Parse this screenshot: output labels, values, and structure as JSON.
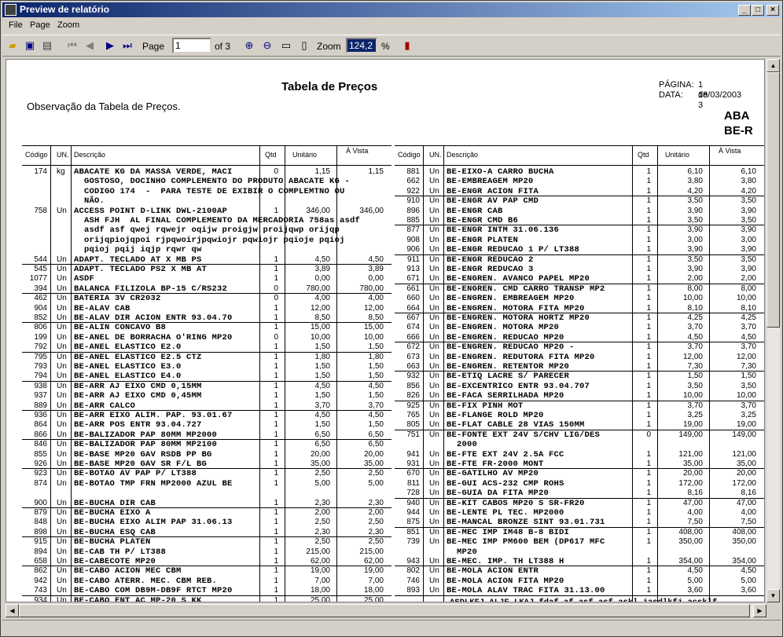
{
  "window": {
    "title": "Preview de relatório"
  },
  "menu": [
    "File",
    "Page",
    "Zoom"
  ],
  "toolbar": {
    "page_label": "Page",
    "page_value": "1",
    "of_label": "of 3",
    "zoom_label": "Zoom",
    "zoom_value": "124,2",
    "percent": "%"
  },
  "report": {
    "title": "Tabela de Preços",
    "observation": "Observação da Tabela de Preços.",
    "page_label": "PÁGINA:",
    "page_value": "1 de 3",
    "date_label": "DATA:",
    "date_value": "18/03/2003",
    "aba1": "ABA",
    "aba2": "BE-R"
  },
  "headers": {
    "code": "Código",
    "unit": "UN.",
    "desc": "Descrição",
    "qty": "Qtd",
    "unit_price": "Unitário",
    "cash": "À Vista"
  },
  "left_rows": [
    {
      "c": "174",
      "u": "kg",
      "d": [
        "ABACATE KG DA MASSA VERDE, MACI",
        "  GOSTOSO, DOCINHO COMPLEMENTO DO PRODUTO ABACATE KG -",
        "  CODIGO 174  -  PARA TESTE DE EXIBIR O COMPLEMTNO OU",
        "  NÃO."
      ],
      "q": "0",
      "p1": "1,15",
      "p2": "1,15"
    },
    {
      "c": "758",
      "u": "Un",
      "d": [
        "ACCESS POINT D-LINK DWL-2100AP",
        "  ASH FJH  AL FINAL COMPLEMENTO DA MERCADORIA 758as asdf",
        "  asdf asf qwej rqwejr oqijw proigjw proijqwp orijqp",
        "  orijqpiojqpoi rjpqwoirjpqwiojr pqwiojr pqioje pqioj",
        "  pqioj pqij iqjp rqwr qw"
      ],
      "q": "1",
      "p1": "346,00",
      "p2": "346,00"
    },
    {
      "c": "544",
      "u": "Un",
      "d": [
        "ADAPT. TECLADO AT X MB PS"
      ],
      "q": "1",
      "p1": "4,50",
      "p2": "4,50"
    },
    {
      "c": "545",
      "u": "Un",
      "d": [
        "ADAPT. TECLADO PS2 X MB AT"
      ],
      "q": "1",
      "p1": "3,89",
      "p2": "3,89"
    },
    {
      "c": "1077",
      "u": "Un",
      "d": [
        "ASDF"
      ],
      "q": "1",
      "p1": "0,00",
      "p2": "0,00"
    },
    {
      "c": "394",
      "u": "Un",
      "d": [
        "BALANCA FILIZOLA BP-15 C/RS232"
      ],
      "q": "0",
      "p1": "780,00",
      "p2": "780,00"
    },
    {
      "c": "462",
      "u": "Un",
      "d": [
        "BATERIA 3V CR2032"
      ],
      "q": "0",
      "p1": "4,00",
      "p2": "4,00"
    },
    {
      "c": "904",
      "u": "Un",
      "d": [
        "BE-ALAV CAB"
      ],
      "q": "1",
      "p1": "12,00",
      "p2": "12,00"
    },
    {
      "c": "852",
      "u": "Un",
      "d": [
        "BE-ALAV DIR ACION ENTR 93.04.70"
      ],
      "q": "1",
      "p1": "8,50",
      "p2": "8,50"
    },
    {
      "c": "806",
      "u": "Un",
      "d": [
        "BE-ALIN CONCAVO B8"
      ],
      "q": "1",
      "p1": "15,00",
      "p2": "15,00"
    },
    {
      "c": "199",
      "u": "Un",
      "d": [
        "BE-ANEL DE BORRACHA O'RING MP20"
      ],
      "q": "0",
      "p1": "10,00",
      "p2": "10,00"
    },
    {
      "c": "792",
      "u": "Un",
      "d": [
        "BE-ANEL ELASTICO E2.0"
      ],
      "q": "1",
      "p1": "1,50",
      "p2": "1,50"
    },
    {
      "c": "795",
      "u": "Un",
      "d": [
        "BE-ANEL ELASTICO E2.5 CTZ"
      ],
      "q": "1",
      "p1": "1,80",
      "p2": "1,80"
    },
    {
      "c": "793",
      "u": "Un",
      "d": [
        "BE-ANEL ELASTICO E3.0"
      ],
      "q": "1",
      "p1": "1,50",
      "p2": "1,50"
    },
    {
      "c": "794",
      "u": "Un",
      "d": [
        "BE-ANEL ELASTICO E4.0"
      ],
      "q": "1",
      "p1": "1,50",
      "p2": "1,50"
    },
    {
      "c": "938",
      "u": "Un",
      "d": [
        "BE-ARR AJ EIXO CMD 0,15MM"
      ],
      "q": "1",
      "p1": "4,50",
      "p2": "4,50"
    },
    {
      "c": "937",
      "u": "Un",
      "d": [
        "BE-ARR AJ EIXO CMD 0,45MM"
      ],
      "q": "1",
      "p1": "1,50",
      "p2": "1,50"
    },
    {
      "c": "889",
      "u": "Un",
      "d": [
        "BE-ARR CALCO"
      ],
      "q": "1",
      "p1": "3,70",
      "p2": "3,70"
    },
    {
      "c": "936",
      "u": "Un",
      "d": [
        "BE-ARR EIXO ALIM. PAP. 93.01.67"
      ],
      "q": "1",
      "p1": "4,50",
      "p2": "4,50"
    },
    {
      "c": "864",
      "u": "Un",
      "d": [
        "BE-ARR POS ENTR 93.04.727"
      ],
      "q": "1",
      "p1": "1,50",
      "p2": "1,50"
    },
    {
      "c": "866",
      "u": "Un",
      "d": [
        "BE-BALIZADOR PAP 80MM MP2000"
      ],
      "q": "1",
      "p1": "6,50",
      "p2": "6,50"
    },
    {
      "c": "846",
      "u": "Un",
      "d": [
        "BE-BALIZADOR PAP 80MM MP2100"
      ],
      "q": "1",
      "p1": "6,50",
      "p2": "6,50"
    },
    {
      "c": "855",
      "u": "Un",
      "d": [
        "BE-BASE MP20 GAV RSDB PP BG"
      ],
      "q": "1",
      "p1": "20,00",
      "p2": "20,00"
    },
    {
      "c": "926",
      "u": "Un",
      "d": [
        "BE-BASE MP20 GAV SR F/L BG"
      ],
      "q": "1",
      "p1": "35,00",
      "p2": "35,00"
    },
    {
      "c": "923",
      "u": "Un",
      "d": [
        "BE-BOTAO AV PAP P/ LT388"
      ],
      "q": "1",
      "p1": "2,50",
      "p2": "2,50"
    },
    {
      "c": "874",
      "u": "Un",
      "d": [
        "BE-BOTAO TMP FRN MP2000 AZUL BE",
        ""
      ],
      "q": "1",
      "p1": "5,00",
      "p2": "5,00"
    },
    {
      "c": "900",
      "u": "Un",
      "d": [
        "BE-BUCHA DIR CAB"
      ],
      "q": "1",
      "p1": "2,30",
      "p2": "2,30"
    },
    {
      "c": "879",
      "u": "Un",
      "d": [
        "BE-BUCHA EIXO A"
      ],
      "q": "1",
      "p1": "2,00",
      "p2": "2,00"
    },
    {
      "c": "848",
      "u": "Un",
      "d": [
        "BE-BUCHA EIXO ALIM PAP 31.06.13"
      ],
      "q": "1",
      "p1": "2,50",
      "p2": "2,50"
    },
    {
      "c": "898",
      "u": "Un",
      "d": [
        "BE-BUCHA ESQ CAB"
      ],
      "q": "1",
      "p1": "2,30",
      "p2": "2,30"
    },
    {
      "c": "915",
      "u": "Un",
      "d": [
        "BE-BUCHA PLATEN"
      ],
      "q": "1",
      "p1": "2,50",
      "p2": "2,50"
    },
    {
      "c": "894",
      "u": "Un",
      "d": [
        "BE-CAB TH P/ LT388"
      ],
      "q": "1",
      "p1": "215,00",
      "p2": "215,00"
    },
    {
      "c": "658",
      "u": "Un",
      "d": [
        "BE-CABECOTE MP20"
      ],
      "q": "1",
      "p1": "62,00",
      "p2": "62,00"
    },
    {
      "c": "862",
      "u": "Un",
      "d": [
        "BE-CABO ACION MEC CBM"
      ],
      "q": "1",
      "p1": "19,00",
      "p2": "19,00"
    },
    {
      "c": "942",
      "u": "Un",
      "d": [
        "BE-CABO ATERR. MEC. CBM REB."
      ],
      "q": "1",
      "p1": "7,00",
      "p2": "7,00"
    },
    {
      "c": "743",
      "u": "Un",
      "d": [
        "BE-CABO COM DB9M-DB9F RTCT MP20"
      ],
      "q": "1",
      "p1": "18,00",
      "p2": "18,00"
    },
    {
      "c": "934",
      "u": "Un",
      "d": [
        "BE-CABO ENT AC MP-20 S KK"
      ],
      "q": "1",
      "p1": "25,00",
      "p2": "25,00"
    }
  ],
  "right_rows": [
    {
      "c": "881",
      "u": "Un",
      "d": [
        "BE-EIXO-A CARRO BUCHA"
      ],
      "q": "1",
      "p1": "6,10",
      "p2": "6,10"
    },
    {
      "c": "662",
      "u": "Un",
      "d": [
        "BE-EMBREAGEM MP20"
      ],
      "q": "1",
      "p1": "3,80",
      "p2": "3,80"
    },
    {
      "c": "922",
      "u": "Un",
      "d": [
        "BE-ENGR ACION FITA"
      ],
      "q": "1",
      "p1": "4,20",
      "p2": "4,20"
    },
    {
      "c": "910",
      "u": "Un",
      "d": [
        "BE-ENGR AV PAP CMD"
      ],
      "q": "1",
      "p1": "3,50",
      "p2": "3,50"
    },
    {
      "c": "896",
      "u": "Un",
      "d": [
        "BE-ENGR CAB"
      ],
      "q": "1",
      "p1": "3,90",
      "p2": "3,90"
    },
    {
      "c": "885",
      "u": "Un",
      "d": [
        "BE-ENGR CMD B6"
      ],
      "q": "1",
      "p1": "3,50",
      "p2": "3,50"
    },
    {
      "c": "877",
      "u": "Un",
      "d": [
        "BE-ENGR INTM 31.06.136"
      ],
      "q": "1",
      "p1": "3,90",
      "p2": "3,90"
    },
    {
      "c": "908",
      "u": "Un",
      "d": [
        "BE-ENGR PLATEN"
      ],
      "q": "1",
      "p1": "3,00",
      "p2": "3,00"
    },
    {
      "c": "906",
      "u": "Un",
      "d": [
        "BE-ENGR REDUCAO 1 P/ LT388"
      ],
      "q": "1",
      "p1": "3,90",
      "p2": "3,90"
    },
    {
      "c": "911",
      "u": "Un",
      "d": [
        "BE-ENGR REDUCAO 2"
      ],
      "q": "1",
      "p1": "3,50",
      "p2": "3,50"
    },
    {
      "c": "913",
      "u": "Un",
      "d": [
        "BE-ENGR REDUCAO 3"
      ],
      "q": "1",
      "p1": "3,90",
      "p2": "3,90"
    },
    {
      "c": "671",
      "u": "Un",
      "d": [
        "BE-ENGREN. AVANCO PAPEL MP20"
      ],
      "q": "1",
      "p1": "2,00",
      "p2": "2,00"
    },
    {
      "c": "661",
      "u": "Un",
      "d": [
        "BE-ENGREN. CMD CARRO TRANSP MP2"
      ],
      "q": "1",
      "p1": "8,00",
      "p2": "8,00"
    },
    {
      "c": "660",
      "u": "Un",
      "d": [
        "BE-ENGREN. EMBREAGEM MP20"
      ],
      "q": "1",
      "p1": "10,00",
      "p2": "10,00"
    },
    {
      "c": "664",
      "u": "Un",
      "d": [
        "BE-ENGREN. MOTORA FITA MP20"
      ],
      "q": "1",
      "p1": "8,10",
      "p2": "8,10"
    },
    {
      "c": "667",
      "u": "Un",
      "d": [
        "BE-ENGREN. MOTORA HORTZ MP20"
      ],
      "q": "1",
      "p1": "4,25",
      "p2": "4,25"
    },
    {
      "c": "674",
      "u": "Un",
      "d": [
        "BE-ENGREN. MOTORA MP20"
      ],
      "q": "1",
      "p1": "3,70",
      "p2": "3,70"
    },
    {
      "c": "666",
      "u": "Un",
      "d": [
        "BE-ENGREN. REDUCAO MP20"
      ],
      "q": "1",
      "p1": "4,50",
      "p2": "4,50"
    },
    {
      "c": "672",
      "u": "Un",
      "d": [
        "BE-ENGREN. REDUCAO MP20 -"
      ],
      "q": "1",
      "p1": "3,70",
      "p2": "3,70"
    },
    {
      "c": "673",
      "u": "Un",
      "d": [
        "BE-ENGREN. REDUTORA FITA MP20"
      ],
      "q": "1",
      "p1": "12,00",
      "p2": "12,00"
    },
    {
      "c": "663",
      "u": "Un",
      "d": [
        "BE-ENGREN. RETENTOR MP20"
      ],
      "q": "1",
      "p1": "7,30",
      "p2": "7,30"
    },
    {
      "c": "932",
      "u": "Un",
      "d": [
        "BE-ETIQ LACRE S/ PARECER"
      ],
      "q": "1",
      "p1": "1,50",
      "p2": "1,50"
    },
    {
      "c": "856",
      "u": "Un",
      "d": [
        "BE-EXCENTRICO ENTR 93.04.707"
      ],
      "q": "1",
      "p1": "3,50",
      "p2": "3,50"
    },
    {
      "c": "826",
      "u": "Un",
      "d": [
        "BE-FACA SERRILHADA MP20"
      ],
      "q": "1",
      "p1": "10,00",
      "p2": "10,00"
    },
    {
      "c": "925",
      "u": "Un",
      "d": [
        "BE-FIX PINH MOT"
      ],
      "q": "1",
      "p1": "3,70",
      "p2": "3,70"
    },
    {
      "c": "765",
      "u": "Un",
      "d": [
        "BE-FLANGE ROLD MP20"
      ],
      "q": "1",
      "p1": "3,25",
      "p2": "3,25"
    },
    {
      "c": "805",
      "u": "Un",
      "d": [
        "BE-FLAT CABLE 28 VIAS 150MM"
      ],
      "q": "1",
      "p1": "19,00",
      "p2": "19,00"
    },
    {
      "c": "751",
      "u": "Un",
      "d": [
        "BE-FONTE EXT 24V S/CHV LIG/DES",
        "  2000"
      ],
      "q": "0",
      "p1": "149,00",
      "p2": "149,00"
    },
    {
      "c": "941",
      "u": "Un",
      "d": [
        "BE-FTE EXT 24V 2.5A FCC"
      ],
      "q": "1",
      "p1": "121,00",
      "p2": "121,00"
    },
    {
      "c": "931",
      "u": "Un",
      "d": [
        "BE-FTE FR-2000 MONT"
      ],
      "q": "1",
      "p1": "35,00",
      "p2": "35,00"
    },
    {
      "c": "670",
      "u": "Un",
      "d": [
        "BE-GATILHO AV MP20"
      ],
      "q": "1",
      "p1": "20,00",
      "p2": "20,00"
    },
    {
      "c": "811",
      "u": "Un",
      "d": [
        "BE-GUI ACS-232 CMP ROHS"
      ],
      "q": "1",
      "p1": "172,00",
      "p2": "172,00"
    },
    {
      "c": "728",
      "u": "Un",
      "d": [
        "BE-GUIA DA FITA MP20"
      ],
      "q": "1",
      "p1": "8,16",
      "p2": "8,16"
    },
    {
      "c": "940",
      "u": "Un",
      "d": [
        "BE-KIT CABOS MP20 S SR-FR20"
      ],
      "q": "1",
      "p1": "47,00",
      "p2": "47,00"
    },
    {
      "c": "944",
      "u": "Un",
      "d": [
        "BE-LENTE PL TEC. MP2000"
      ],
      "q": "1",
      "p1": "4,00",
      "p2": "4,00"
    },
    {
      "c": "875",
      "u": "Un",
      "d": [
        "BE-MANCAL BRONZE SINT 93.01.731"
      ],
      "q": "1",
      "p1": "7,50",
      "p2": "7,50"
    },
    {
      "c": "851",
      "u": "Un",
      "d": [
        "BE-MEC IMP IM48 B-8 BIDI"
      ],
      "q": "1",
      "p1": "408,00",
      "p2": "408,00"
    },
    {
      "c": "739",
      "u": "Un",
      "d": [
        "BE-MEC IMP PM600 BEM (DP617 MFC",
        "  MP20"
      ],
      "q": "1",
      "p1": "350,00",
      "p2": "350,00"
    },
    {
      "c": "943",
      "u": "Un",
      "d": [
        "BE-MEC. IMP. TH LT388 H"
      ],
      "q": "1",
      "p1": "354,00",
      "p2": "354,00"
    },
    {
      "c": "802",
      "u": "Un",
      "d": [
        "BE-MOLA ACION ENTR"
      ],
      "q": "1",
      "p1": "4,50",
      "p2": "4,50"
    },
    {
      "c": "746",
      "u": "Un",
      "d": [
        "BE-MOLA ACION FITA MP20"
      ],
      "q": "1",
      "p1": "5,00",
      "p2": "5,00"
    },
    {
      "c": "893",
      "u": "Un",
      "d": [
        "BE-MOLA ALAV TRAC FITA 31.13.00"
      ],
      "q": "1",
      "p1": "3,60",
      "p2": "3,60"
    }
  ],
  "right_tail": "ASDLKFJ ALJF LKAJ fdaf af asf asf askl jasdlkfj açsklf"
}
